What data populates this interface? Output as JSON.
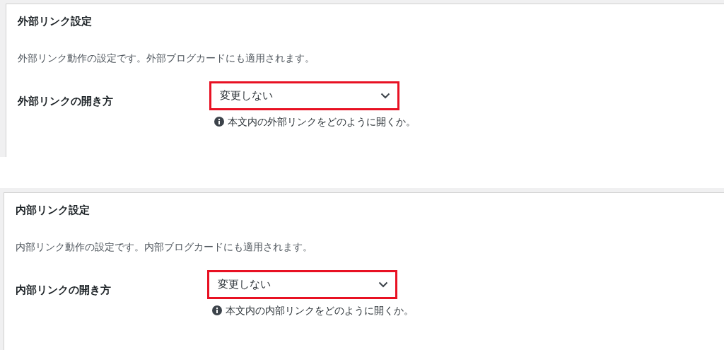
{
  "sections": [
    {
      "title": "外部リンク設定",
      "description": "外部リンク動作の設定です。外部ブログカードにも適用されます。",
      "settings": [
        {
          "label": "外部リンクの開き方",
          "value": "変更しない",
          "highlighted": true,
          "hint": "本文内の外部リンクをどのように開くか。"
        }
      ]
    },
    {
      "title": "内部リンク設定",
      "description": "内部リンク動作の設定です。内部ブログカードにも適用されます。",
      "settings": [
        {
          "label": "内部リンクの開き方",
          "value": "変更しない",
          "highlighted": true,
          "hint": "本文内の内部リンクをどのように開くか。"
        }
      ]
    }
  ]
}
